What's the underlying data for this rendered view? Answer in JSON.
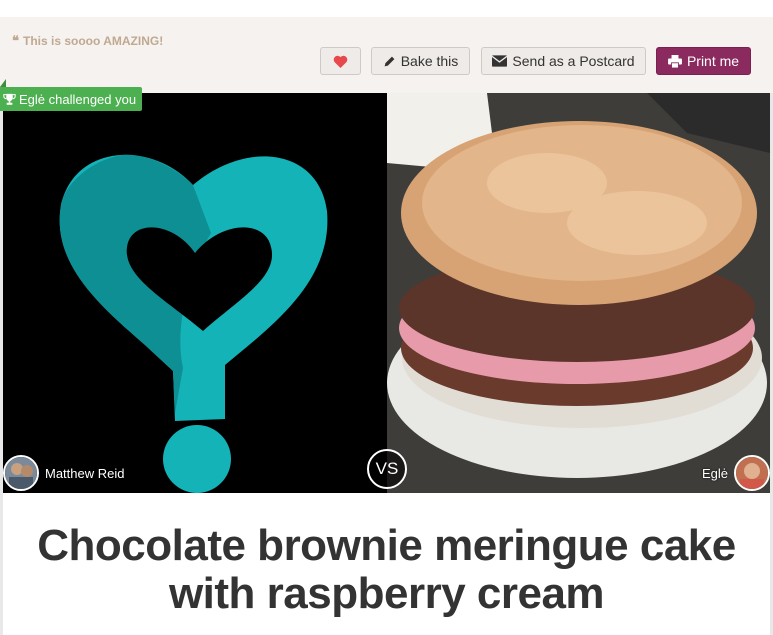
{
  "toolbar": {
    "quote_text": "This is soooo AMAZING!",
    "like_icon": "heart-icon",
    "bake_label": "Bake this",
    "postcard_label": "Send as a Postcard",
    "print_label": "Print me"
  },
  "challenge": {
    "badge_text": "Eglė challenged you"
  },
  "versus": {
    "left_user": "Matthew Reid",
    "vs_label": "VS",
    "right_user": "Eglė"
  },
  "recipe": {
    "title": "Chocolate brownie meringue cake with raspberry cream"
  },
  "colors": {
    "toolbar_bg": "#f5f2f0",
    "print_button": "#8a2a5e",
    "badge_green": "#4caf50",
    "heart_red": "#e8474c",
    "placeholder_teal": "#14b3b8"
  }
}
